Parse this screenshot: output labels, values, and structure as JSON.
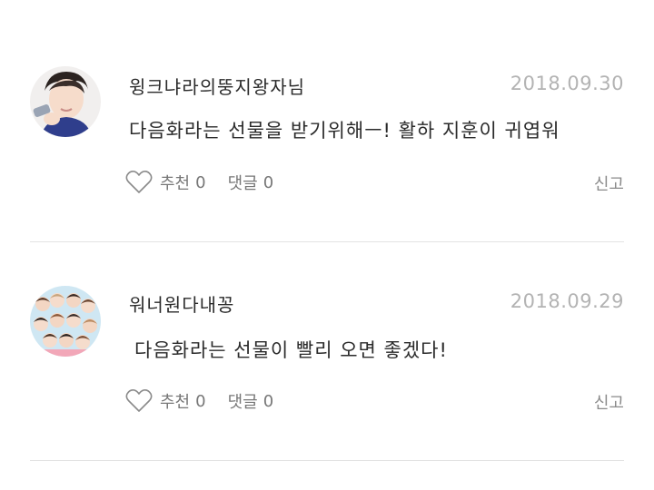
{
  "comments": [
    {
      "nickname": "윙크냐라의뚱지왕자님",
      "date": "2018.09.30",
      "text": "다음화라는 선물을 받기위해ㅡ! 활하 지훈이 귀엽워",
      "like_label": "추천",
      "like_count": "0",
      "reply_label": "댓글",
      "reply_count": "0",
      "report_label": "신고"
    },
    {
      "nickname": "워너원다내꽁",
      "date": "2018.09.29",
      "text": "다음화라는 선물이 빨리 오면 좋겠다!",
      "like_label": "추천",
      "like_count": "0",
      "reply_label": "댓글",
      "reply_count": "0",
      "report_label": "신고"
    }
  ],
  "colors": {
    "text": "#2a2a2a",
    "date": "#b3b3b3",
    "meta": "#777777",
    "divider": "#e3e3e3"
  },
  "icons": {
    "like": "heart-outline-icon"
  }
}
